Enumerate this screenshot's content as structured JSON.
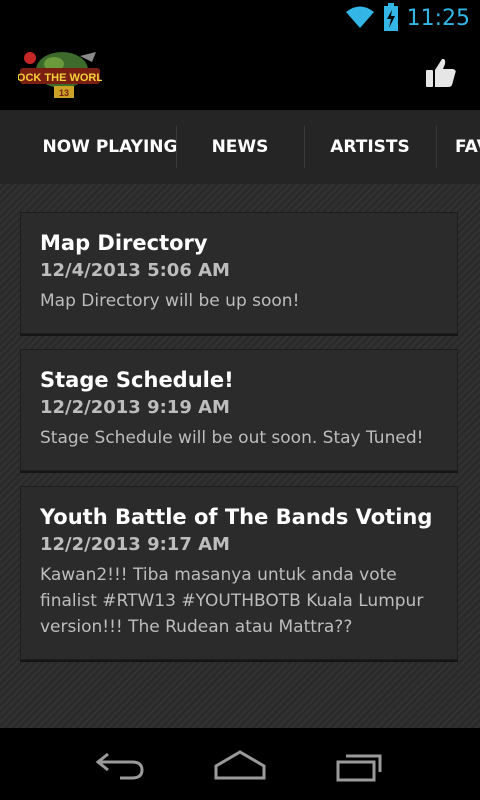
{
  "status_bar": {
    "time": "11:25",
    "icons": [
      "wifi-icon",
      "battery-charging-icon"
    ]
  },
  "action_bar": {
    "logo_text": "ROCK THE WORLD",
    "logo_badge": "13",
    "like_icon": "thumbs-up-icon"
  },
  "tabs": [
    {
      "label": "NOW PLAYING"
    },
    {
      "label": "NEWS",
      "selected": true
    },
    {
      "label": "ARTISTS"
    },
    {
      "label": "FAV"
    }
  ],
  "news": [
    {
      "title": "Map Directory",
      "date": "12/4/2013 5:06 AM",
      "body": "Map Directory will be up soon!"
    },
    {
      "title": "Stage Schedule!",
      "date": "12/2/2013 9:19 AM",
      "body": "Stage Schedule will be out soon. Stay Tuned!"
    },
    {
      "title": "Youth Battle of The Bands Voting",
      "date": "12/2/2013 9:17 AM",
      "body": "Kawan2!!! Tiba masanya untuk anda vote finalist #RTW13 #YOUTHBOTB Kuala Lumpur version!!! The Rudean atau Mattra??"
    }
  ],
  "nav_bar": {
    "buttons": [
      "back-icon",
      "home-icon",
      "recent-apps-icon"
    ]
  },
  "colors": {
    "accent": "#33b5e5",
    "tab_bar": "#252525",
    "card": "#2b2b2b",
    "text_secondary": "#bdbdbd"
  }
}
